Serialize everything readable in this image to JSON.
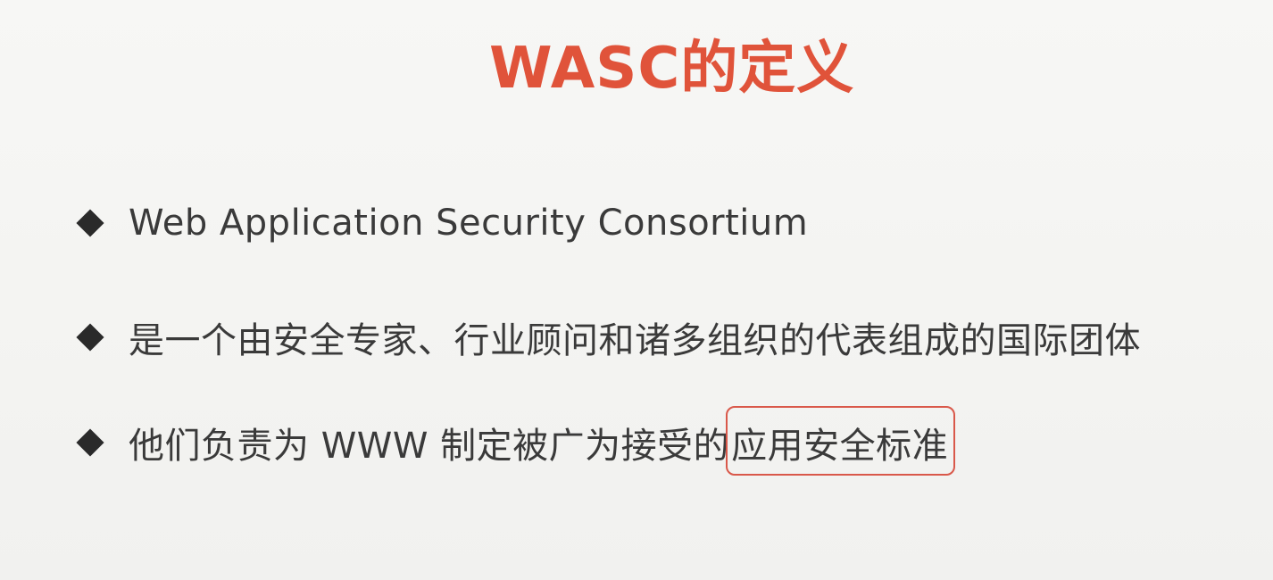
{
  "slide": {
    "title": "WASC的定义",
    "bullets": [
      {
        "text": "Web Application Security Consortium"
      },
      {
        "text": "是一个由安全专家、行业顾问和诸多组织的代表组成的国际团体"
      },
      {
        "text_before": "他们负责为 WWW 制定被广为接受的",
        "text_highlight": "应用安全标准"
      }
    ]
  },
  "colors": {
    "title": "#e0533a",
    "body_text": "#3a3a3a",
    "bullet": "#2a2a2a",
    "highlight_border": "#d9584a",
    "background": "#f5f5f3"
  },
  "icons": {
    "bullet": "diamond-bullet-icon"
  }
}
